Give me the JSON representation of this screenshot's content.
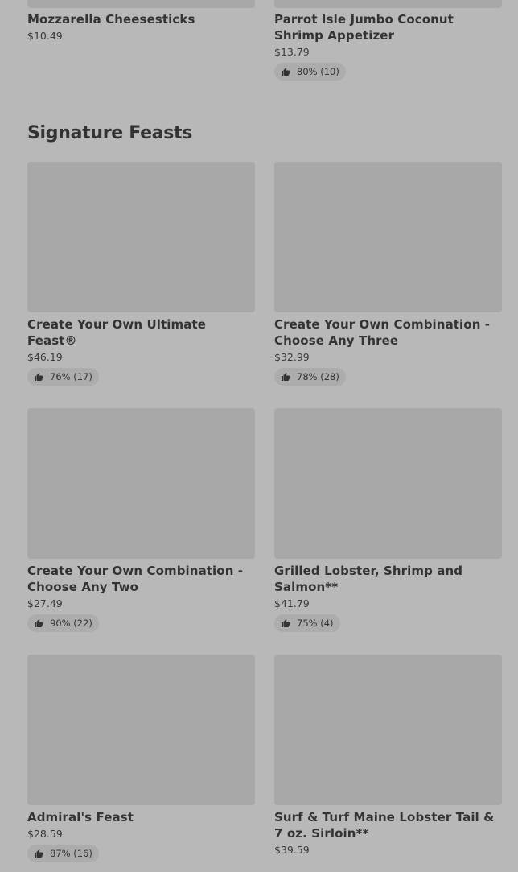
{
  "top_items": [
    {
      "name": "Mozzarella Cheesesticks",
      "price": "$10.49"
    },
    {
      "name": "Parrot Isle Jumbo Coconut Shrimp Appetizer",
      "price": "$13.79",
      "rating": "80% (10)"
    }
  ],
  "section": {
    "title": "Signature Feasts",
    "items": [
      {
        "name": "Create Your Own Ultimate Feast®",
        "price": "$46.19",
        "rating": "76% (17)"
      },
      {
        "name": "Create Your Own Combination - Choose Any Three",
        "price": "$32.99",
        "rating": "78% (28)"
      },
      {
        "name": "Create Your Own Combination - Choose Any Two",
        "price": "$27.49",
        "rating": "90% (22)"
      },
      {
        "name": "Grilled Lobster, Shrimp and Salmon**",
        "price": "$41.79",
        "rating": "75% (4)"
      },
      {
        "name": "Admiral's Feast",
        "price": "$28.59",
        "rating": "87% (16)"
      },
      {
        "name": "Surf & Turf Maine Lobster Tail & 7 oz. Sirloin**",
        "price": "$39.59"
      }
    ]
  },
  "icons": {
    "rating": "thumbs-up-icon"
  },
  "colors": {
    "background": "#b8b8b8",
    "image_placeholder": "#a8a8a8",
    "rating_pill": "#acacac",
    "text": "#333333"
  }
}
